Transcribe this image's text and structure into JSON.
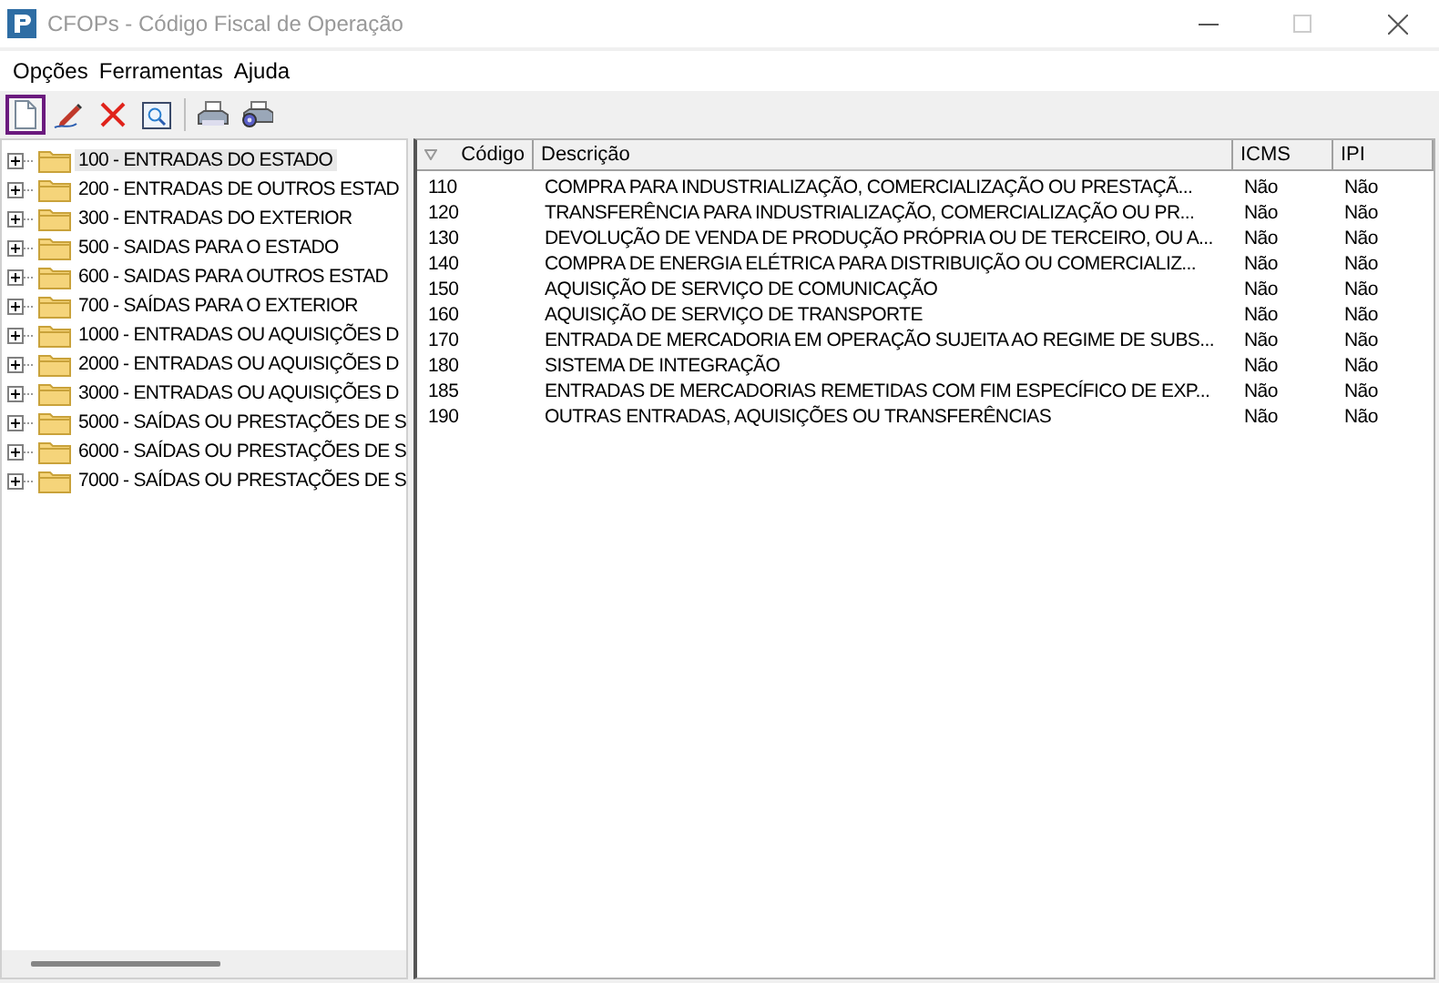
{
  "window": {
    "title": "CFOPs - Código Fiscal de Operação"
  },
  "menu": [
    "Opções",
    "Ferramentas",
    "Ajuda"
  ],
  "toolbar": [
    {
      "kind": "new",
      "highlighted": true
    },
    {
      "kind": "edit",
      "highlighted": false
    },
    {
      "kind": "delete",
      "highlighted": false
    },
    {
      "kind": "preview",
      "highlighted": false
    },
    {
      "kind": "separator"
    },
    {
      "kind": "print",
      "highlighted": false
    },
    {
      "kind": "print-setup",
      "highlighted": false
    }
  ],
  "tree": [
    {
      "label": "100 - ENTRADAS DO ESTADO",
      "selected": true,
      "expanded": false
    },
    {
      "label": "200 - ENTRADAS DE OUTROS ESTAD",
      "selected": false,
      "expanded": false
    },
    {
      "label": "300 - ENTRADAS DO EXTERIOR",
      "selected": false,
      "expanded": false
    },
    {
      "label": "500 - SAIDAS PARA O ESTADO",
      "selected": false,
      "expanded": false
    },
    {
      "label": "600 - SAIDAS PARA OUTROS ESTAD",
      "selected": false,
      "expanded": false
    },
    {
      "label": "700 - SAÍDAS PARA O EXTERIOR",
      "selected": false,
      "expanded": false
    },
    {
      "label": "1000 - ENTRADAS OU AQUISIÇÕES D",
      "selected": false,
      "expanded": false
    },
    {
      "label": "2000 - ENTRADAS OU AQUISIÇÕES D",
      "selected": false,
      "expanded": false
    },
    {
      "label": "3000 - ENTRADAS OU AQUISIÇÕES D",
      "selected": false,
      "expanded": false
    },
    {
      "label": "5000 - SAÍDAS OU PRESTAÇÕES DE S",
      "selected": false,
      "expanded": false
    },
    {
      "label": "6000 - SAÍDAS OU PRESTAÇÕES DE S",
      "selected": false,
      "expanded": false
    },
    {
      "label": "7000 - SAÍDAS OU PRESTAÇÕES DE S",
      "selected": false,
      "expanded": false
    }
  ],
  "table": {
    "columns": [
      {
        "label": "Código",
        "sorted": true
      },
      {
        "label": "Descrição",
        "sorted": false
      },
      {
        "label": "ICMS",
        "sorted": false
      },
      {
        "label": "IPI",
        "sorted": false
      }
    ],
    "rows": [
      [
        "110",
        "COMPRA PARA INDUSTRIALIZAÇÃO, COMERCIALIZAÇÃO OU PRESTAÇÃ...",
        "Não",
        "Não"
      ],
      [
        "120",
        "TRANSFERÊNCIA PARA INDUSTRIALIZAÇÃO, COMERCIALIZAÇÃO OU PR...",
        "Não",
        "Não"
      ],
      [
        "130",
        "DEVOLUÇÃO DE VENDA DE PRODUÇÃO PRÓPRIA OU DE TERCEIRO, OU A...",
        "Não",
        "Não"
      ],
      [
        "140",
        "COMPRA DE ENERGIA ELÉTRICA PARA DISTRIBUIÇÃO OU COMERCIALIZ...",
        "Não",
        "Não"
      ],
      [
        "150",
        "AQUISIÇÃO DE SERVIÇO DE COMUNICAÇÃO",
        "Não",
        "Não"
      ],
      [
        "160",
        "AQUISIÇÃO DE SERVIÇO DE TRANSPORTE",
        "Não",
        "Não"
      ],
      [
        "170",
        "ENTRADA DE MERCADORIA EM OPERAÇÃO SUJEITA AO REGIME DE SUBS...",
        "Não",
        "Não"
      ],
      [
        "180",
        "SISTEMA DE INTEGRAÇÃO",
        "Não",
        "Não"
      ],
      [
        "185",
        "ENTRADAS DE MERCADORIAS REMETIDAS COM FIM ESPECÍFICO DE EXP...",
        "Não",
        "Não"
      ],
      [
        "190",
        "OUTRAS ENTRADAS, AQUISIÇÕES OU TRANSFERÊNCIAS",
        "Não",
        "Não"
      ]
    ]
  }
}
